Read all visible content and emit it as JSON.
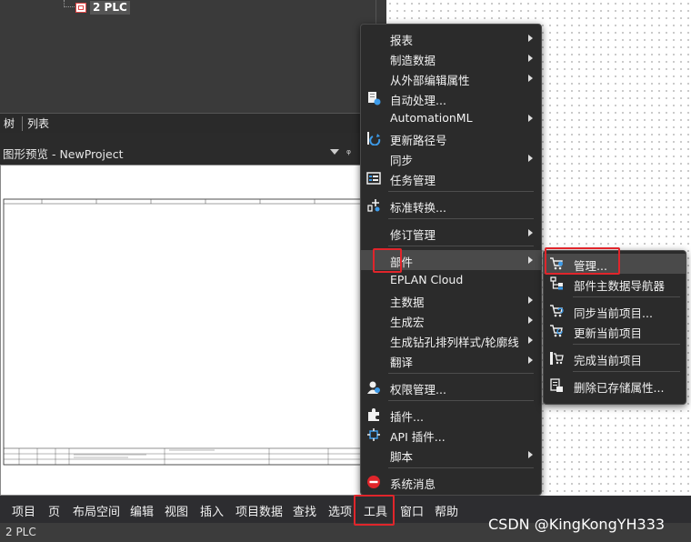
{
  "tree": {
    "node_label": "2 PLC"
  },
  "tabs": {
    "tree": "树",
    "list": "列表"
  },
  "preview": {
    "title": "图形预览 - NewProject",
    "pin_glyph": "ᵩ"
  },
  "context_menu": {
    "items": [
      {
        "label": "报表",
        "submenu": true
      },
      {
        "label": "制造数据",
        "submenu": true
      },
      {
        "label": "从外部编辑属性",
        "submenu": true
      },
      {
        "label": "自动处理...",
        "icon": "auto-process-icon"
      },
      {
        "label": "AutomationML",
        "submenu": true
      },
      {
        "label": "更新路径号",
        "icon": "update-path-icon"
      },
      {
        "label": "同步",
        "submenu": true
      },
      {
        "label": "任务管理",
        "icon": "task-manager-icon"
      },
      {
        "label": "标准转换...",
        "icon": "standard-convert-icon"
      },
      {
        "label": "修订管理",
        "submenu": true
      },
      {
        "label": "部件",
        "submenu": true,
        "highlighted": true
      },
      {
        "label": "EPLAN Cloud"
      },
      {
        "label": "主数据",
        "submenu": true
      },
      {
        "label": "生成宏",
        "submenu": true
      },
      {
        "label": "生成钻孔排列样式/轮廓线",
        "submenu": true
      },
      {
        "label": "翻译",
        "submenu": true
      },
      {
        "label": "权限管理...",
        "icon": "permission-icon"
      },
      {
        "label": "插件...",
        "icon": "plugin-icon"
      },
      {
        "label": "API 插件...",
        "icon": "api-plugin-icon"
      },
      {
        "label": "脚本",
        "submenu": true
      },
      {
        "label": "系统消息",
        "icon": "system-message-icon"
      }
    ]
  },
  "parts_submenu": {
    "items": [
      {
        "label": "管理...",
        "icon": "parts-manage-icon",
        "highlighted": true
      },
      {
        "label": "部件主数据导航器",
        "icon": "parts-navigator-icon"
      },
      {
        "label": "同步当前项目...",
        "icon": "sync-project-icon"
      },
      {
        "label": "更新当前项目",
        "icon": "update-project-icon"
      },
      {
        "label": "完成当前项目",
        "icon": "complete-project-icon"
      },
      {
        "label": "删除已存储属性...",
        "icon": "delete-properties-icon"
      }
    ]
  },
  "menubar": {
    "items": [
      "项目",
      "页",
      "布局空间",
      "编辑",
      "视图",
      "插入",
      "项目数据",
      "查找",
      "选项",
      "工具",
      "窗口",
      "帮助"
    ]
  },
  "status_bar": {
    "text": "2 PLC"
  },
  "watermark": "CSDN @KingKongYH333",
  "colors": {
    "highlight_box": "#e0252b",
    "menu_bg": "#2b2b2b",
    "menubar_bg": "#2d2d30"
  }
}
